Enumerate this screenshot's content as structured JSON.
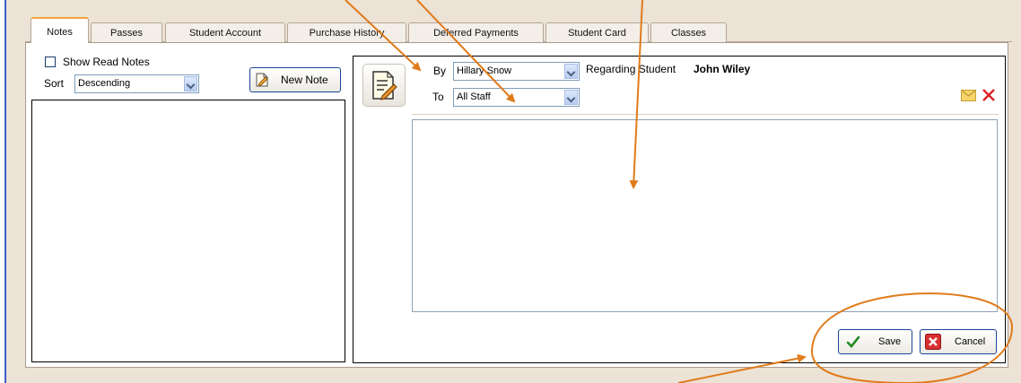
{
  "tabs": [
    {
      "label": "Notes",
      "active": true
    },
    {
      "label": "Passes",
      "active": false
    },
    {
      "label": "Student Account",
      "active": false
    },
    {
      "label": "Purchase History",
      "active": false
    },
    {
      "label": "Deferred Payments",
      "active": false
    },
    {
      "label": "Student Card",
      "active": false
    },
    {
      "label": "Classes",
      "active": false
    }
  ],
  "left": {
    "show_read_label": "Show Read Notes",
    "show_read_checked": false,
    "sort_label": "Sort",
    "sort_value": "Descending",
    "new_note_label": "New Note"
  },
  "note": {
    "by_label": "By",
    "by_value": "Hillary Snow",
    "to_label": "To",
    "to_value": "All Staff",
    "regarding_label": "Regarding Student",
    "student_name": "John Wiley"
  },
  "actions": {
    "save_label": "Save",
    "cancel_label": "Cancel"
  },
  "colors": {
    "annotation": "#e07b1a",
    "tab_active_accent": "#f2a33a",
    "window_bg": "#ece2d6"
  },
  "icons": [
    "note-edit-icon",
    "new-note-icon",
    "envelope-icon",
    "delete-x-icon",
    "checkmark-icon",
    "cancel-x-icon"
  ]
}
